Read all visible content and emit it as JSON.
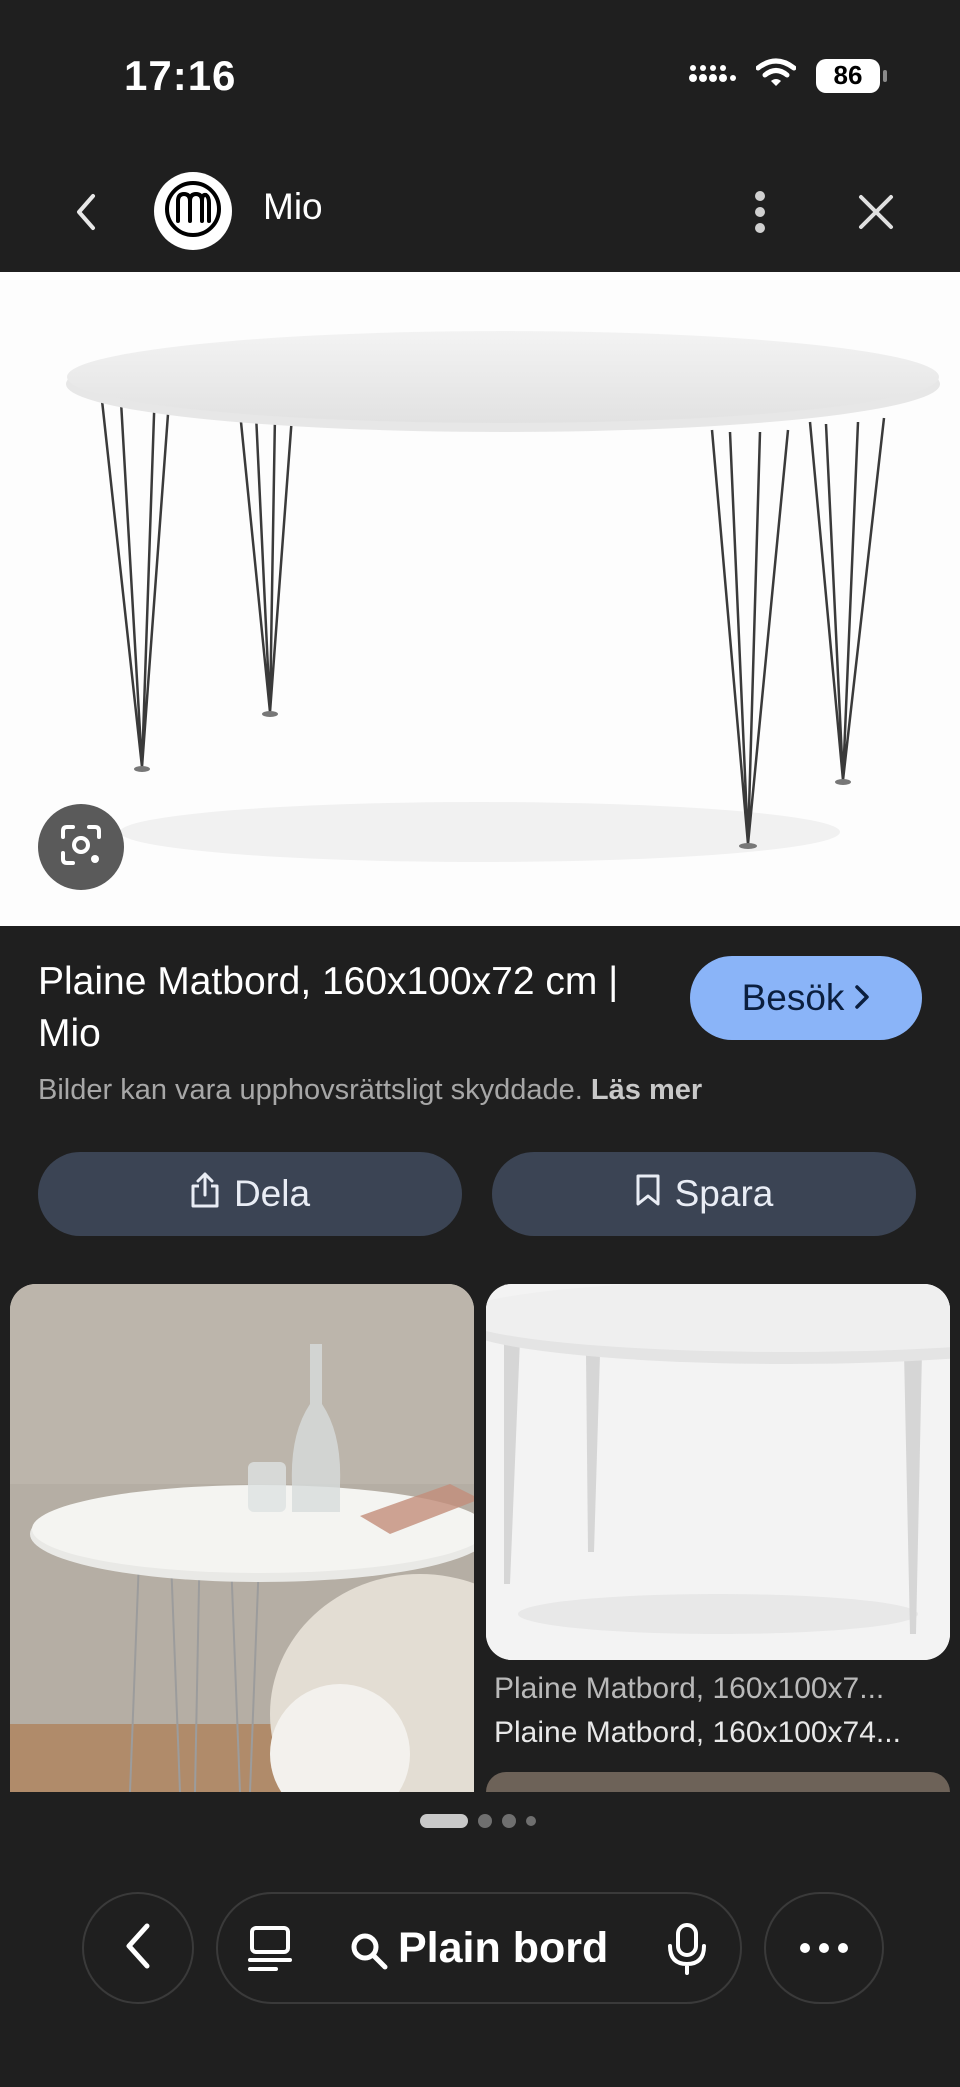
{
  "status_bar": {
    "time": "17:16",
    "battery": "86"
  },
  "header": {
    "site_name": "Mio"
  },
  "result": {
    "title": "Plaine Matbord, 160x100x72 cm | Mio",
    "visit_label": "Besök",
    "copyright_text": "Bilder kan vara upphovsrättsligt skyddade.",
    "read_more_label": "Läs mer"
  },
  "actions": {
    "share_label": "Dela",
    "save_label": "Spara"
  },
  "related": [
    {
      "source": "Plaine Matbord, 160x100x7...",
      "title": "Plaine Matbord, 160x100x74..."
    }
  ],
  "search": {
    "query": "Plain bord"
  },
  "colors": {
    "background": "#1f1f1f",
    "accent": "#8ab4f8",
    "button_bg": "#3b4454"
  }
}
